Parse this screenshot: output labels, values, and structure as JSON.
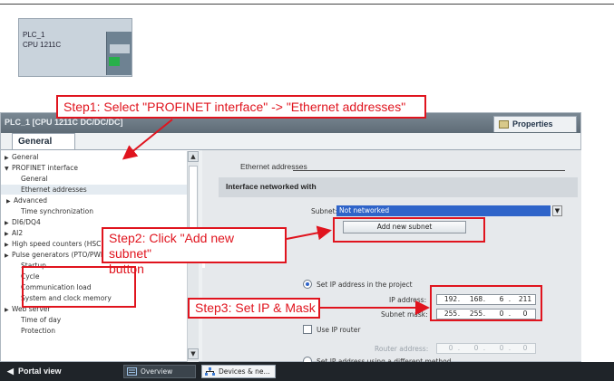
{
  "device": {
    "name": "PLC_1",
    "model": "CPU 1211C"
  },
  "window": {
    "title": "PLC_1 [CPU 1211C DC/DC/DC]",
    "properties_tab": "Properties",
    "general_tab": "General"
  },
  "tree": {
    "items": [
      {
        "label": "General",
        "arrow": "▶"
      },
      {
        "label": "PROFINET interface",
        "arrow": "▼"
      },
      {
        "label": "General",
        "arrow": ""
      },
      {
        "label": "Ethernet addresses",
        "arrow": ""
      },
      {
        "label": "Advanced",
        "arrow": "▶"
      },
      {
        "label": "Time synchronization",
        "arrow": ""
      },
      {
        "label": "DI6/DQ4",
        "arrow": "▶"
      },
      {
        "label": "AI2",
        "arrow": "▶"
      },
      {
        "label": "High speed counters (HSC)",
        "arrow": "▶"
      },
      {
        "label": "Pulse generators (PTO/PWM)",
        "arrow": "▶"
      },
      {
        "label": "Startup",
        "arrow": ""
      },
      {
        "label": "Cycle",
        "arrow": ""
      },
      {
        "label": "Communication load",
        "arrow": ""
      },
      {
        "label": "System and clock memory",
        "arrow": ""
      },
      {
        "label": "Web server",
        "arrow": "▶"
      },
      {
        "label": "Time of day",
        "arrow": ""
      },
      {
        "label": "Protection",
        "arrow": ""
      }
    ],
    "scroll_up": "▲",
    "scroll_down": "▼"
  },
  "content": {
    "section_title": "Ethernet addresses",
    "interface_title": "Interface networked with",
    "subnet_label": "Subnet:",
    "subnet_value": "Not networked",
    "add_subnet_button": "Add new subnet",
    "set_ip_label": "Set IP address in the project",
    "ip_label": "IP address:",
    "ip_octets": [
      "192",
      "168",
      "6",
      "211"
    ],
    "mask_label": "Subnet mask:",
    "mask_octets": [
      "255",
      "255",
      "0",
      "0"
    ],
    "use_router_label": "Use IP router",
    "router_label": "Router address:",
    "router_octets": [
      "0",
      "0",
      "0",
      "0"
    ],
    "other_method_label": "Set IP address using a different method"
  },
  "taskbar": {
    "portal_view": "Portal view",
    "overview": "Overview",
    "devices": "Devices & ne..."
  },
  "annotations": {
    "step1": "Step1: Select \"PROFINET interface\" -> \"Ethernet addresses\"",
    "step2_line1": "Step2: Click \"Add new subnet\"",
    "step2_line2": "button",
    "step3": "Step3: Set IP & Mask",
    "color": "#e0141e"
  }
}
